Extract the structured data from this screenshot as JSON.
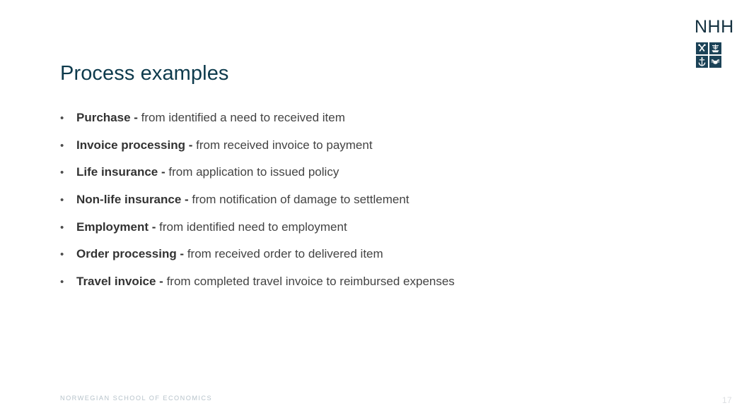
{
  "slide": {
    "title": "Process examples",
    "page_number": "17",
    "background_color": "#ffffff",
    "title_color": "#0d3a4c",
    "body_color": "#404040"
  },
  "brand": {
    "wordmark": "NHH",
    "wordmark_color": "#13303f",
    "emblem_color": "#1b4257",
    "emblem_symbols": [
      "crossed-hammers-icon",
      "sailing-ship-icon",
      "anchor-icon",
      "ox-head-icon"
    ]
  },
  "bullets": [
    {
      "marker": "•",
      "lead": "Purchase -",
      "rest": " from identified a need to received item"
    },
    {
      "marker": "•",
      "lead": "Invoice processing -",
      "rest": " from received invoice to payment"
    },
    {
      "marker": "•",
      "lead": "Life insurance -",
      "rest": " from application to issued policy"
    },
    {
      "marker": "•",
      "lead": "Non-life insurance -",
      "rest": " from notification of damage to settlement"
    },
    {
      "marker": "•",
      "lead": "Employment -",
      "rest": " from identified need to employment"
    },
    {
      "marker": "•",
      "lead": "Order processing -",
      "rest": " from received order to delivered item"
    },
    {
      "marker": "•",
      "lead": "Travel invoice -",
      "rest": " from completed travel invoice to reimbursed expenses"
    }
  ],
  "footer": {
    "institution": "NORWEGIAN SCHOOL OF ECONOMICS",
    "color": "#b7c3cb"
  }
}
